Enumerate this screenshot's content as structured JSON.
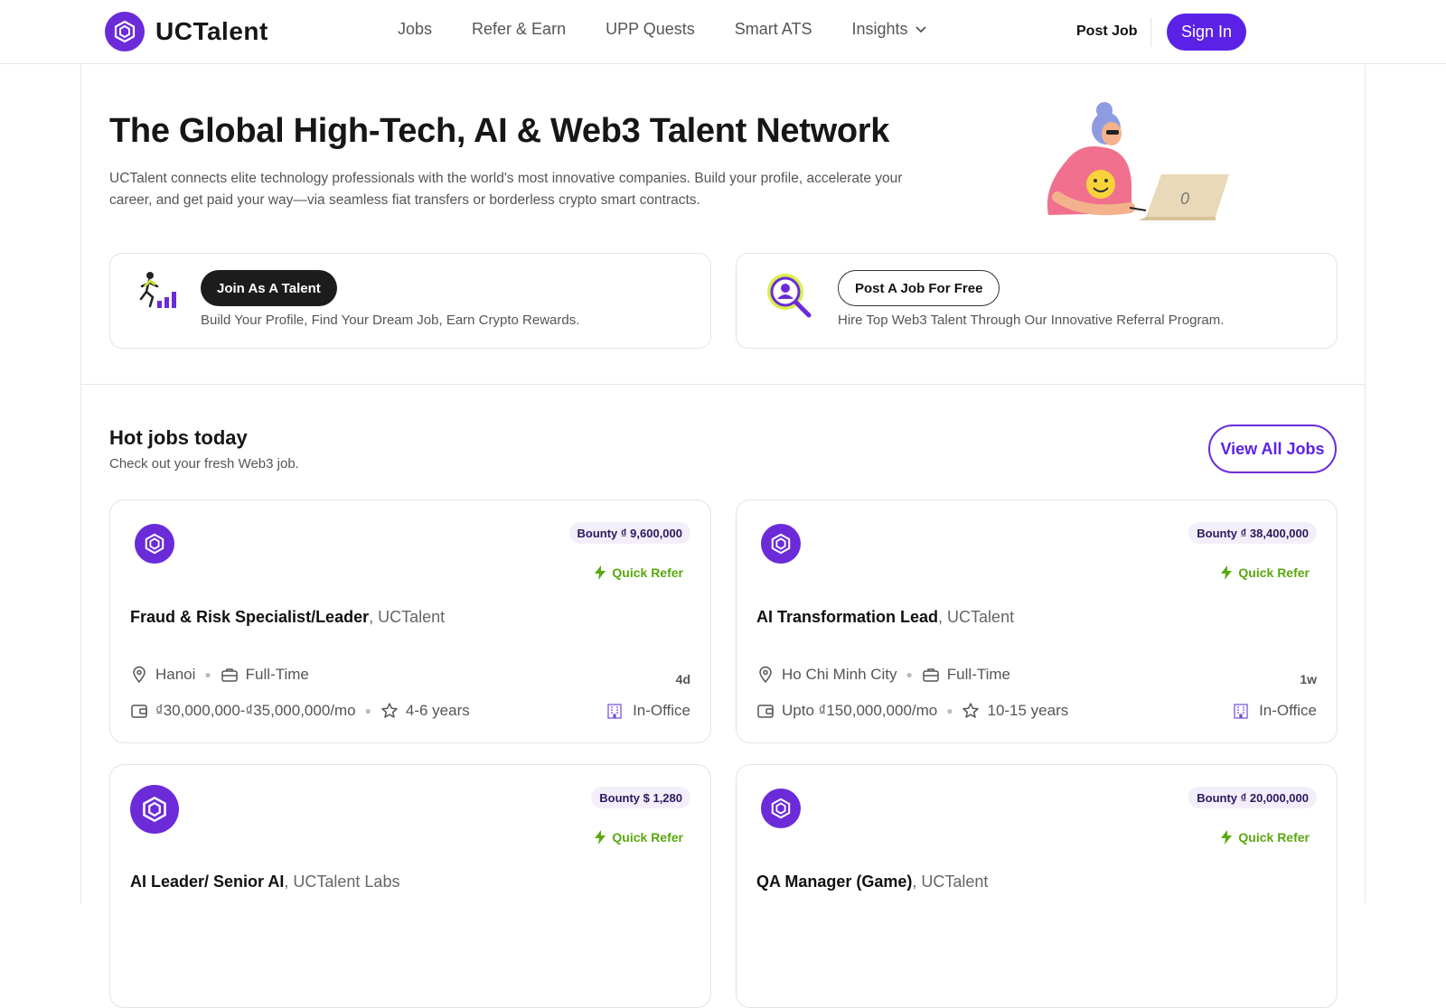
{
  "header": {
    "brand": "UCTalent",
    "nav": [
      {
        "label": "Jobs"
      },
      {
        "label": "Refer & Earn"
      },
      {
        "label": "UPP Quests"
      },
      {
        "label": "Smart ATS"
      },
      {
        "label": "Insights"
      }
    ],
    "post_job": "Post Job",
    "sign_in": "Sign In"
  },
  "hero": {
    "title": "The Global High-Tech, AI & Web3 Talent Network",
    "description": "UCTalent connects elite technology professionals with the world's most innovative companies. Build your profile, accelerate your career, and get paid your way—via seamless fiat transfers or borderless crypto smart contracts.",
    "illustration_digit": "0"
  },
  "cta": {
    "talent": {
      "button": "Join As A Talent",
      "sub": "Build Your Profile, Find Your Dream Job, Earn Crypto Rewards."
    },
    "employer": {
      "button": "Post A Job For Free",
      "sub": "Hire Top Web3 Talent Through Our Innovative Referral Program."
    }
  },
  "hot_jobs": {
    "title": "Hot jobs today",
    "subtitle": "Check out your fresh Web3 job.",
    "view_all": "View All Jobs",
    "jobs": [
      {
        "bounty": "Bounty ₫ 9,600,000",
        "quick_refer": "Quick Refer",
        "title": "Fraud & Risk Specialist/Leader",
        "company": ", UCTalent",
        "location": "Hanoi",
        "type": "Full-Time",
        "age": "4d",
        "salary": "₫30,000,000-₫35,000,000/mo",
        "experience": "4-6 years",
        "workplace": "In-Office"
      },
      {
        "bounty": "Bounty ₫ 38,400,000",
        "quick_refer": "Quick Refer",
        "title": "AI Transformation Lead",
        "company": ", UCTalent",
        "location": "Ho Chi Minh City",
        "type": "Full-Time",
        "age": "1w",
        "salary": "Upto ₫150,000,000/mo",
        "experience": "10-15 years",
        "workplace": "In-Office"
      },
      {
        "bounty": "Bounty $ 1,280",
        "quick_refer": "Quick Refer",
        "title": "AI Leader/ Senior AI",
        "company": ", UCTalent Labs"
      },
      {
        "bounty": "Bounty ₫ 20,000,000",
        "quick_refer": "Quick Refer",
        "title": "QA Manager (Game)",
        "company": ", UCTalent"
      }
    ]
  },
  "colors": {
    "brand_purple": "#6b2bd9",
    "button_purple": "#5b21e6",
    "quick_refer_green": "#5aa80f"
  },
  "icons": [
    "uctalent-logo-icon",
    "chevron-down-icon",
    "runner-chart-icon",
    "magnifier-person-icon",
    "bolt-icon",
    "location-pin-icon",
    "briefcase-icon",
    "wallet-icon",
    "star-icon",
    "building-icon"
  ]
}
